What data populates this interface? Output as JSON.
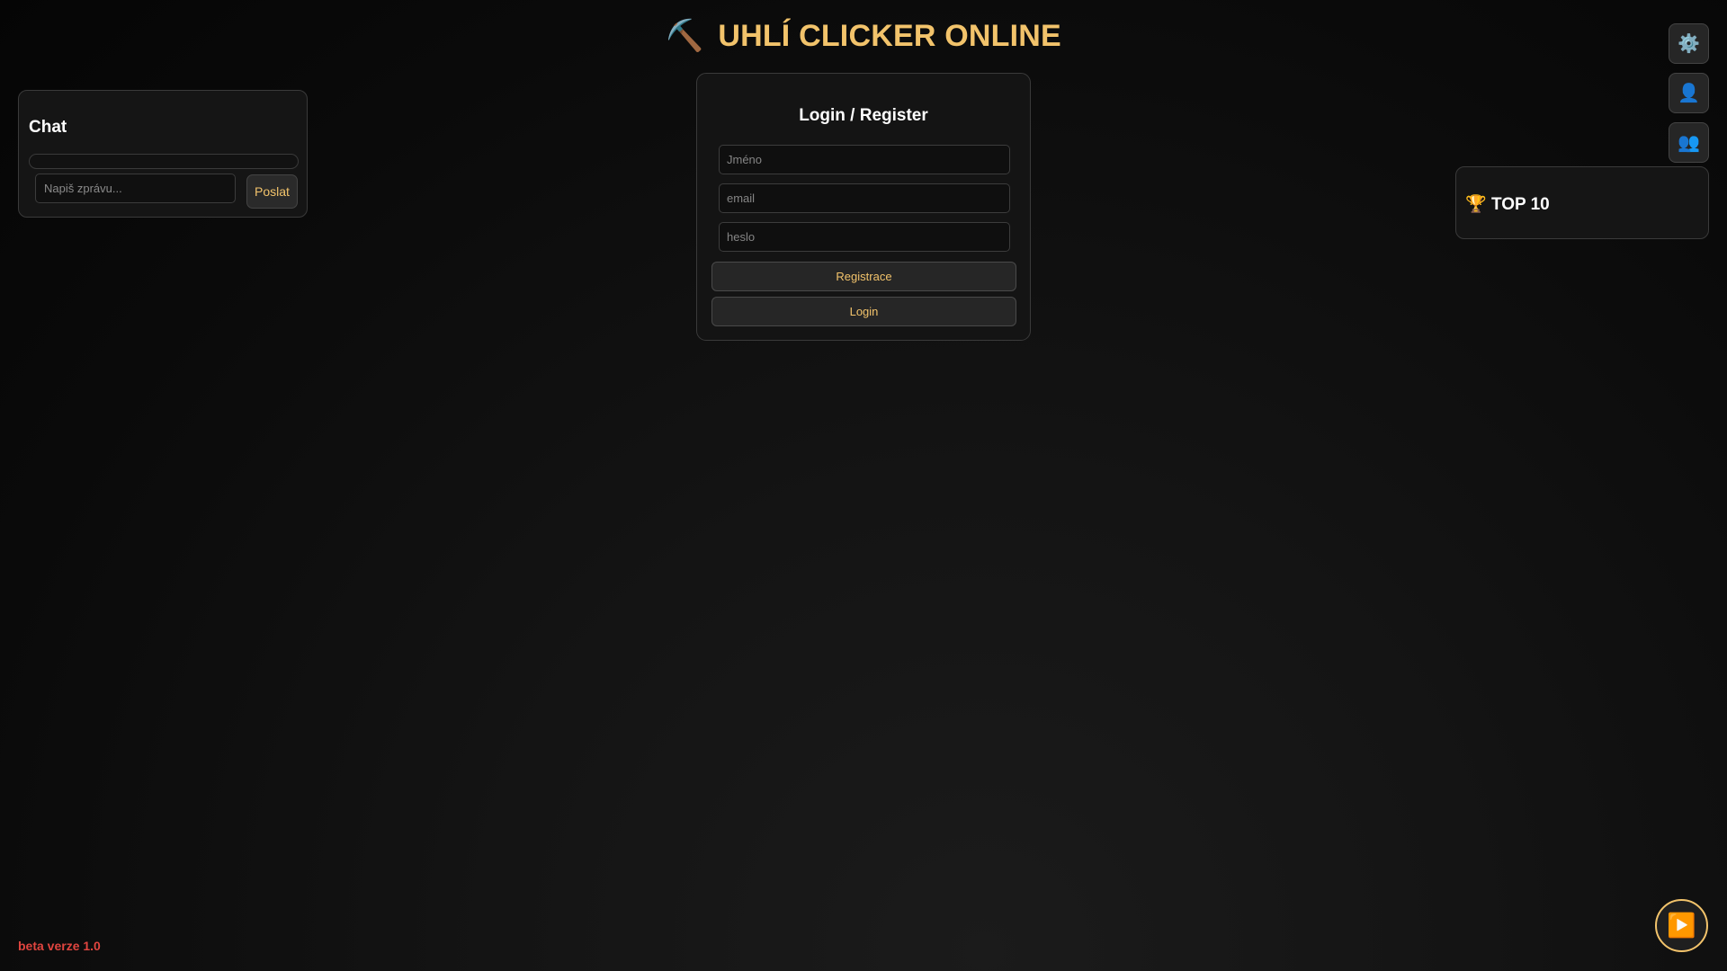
{
  "header": {
    "icon": "⛏️",
    "title": "UHLÍ CLICKER ONLINE"
  },
  "chat": {
    "title": "Chat",
    "input_placeholder": "Napiš zprávu...",
    "send_label": "Poslat"
  },
  "login": {
    "title": "Login / Register",
    "name_placeholder": "Jméno",
    "email_placeholder": "email",
    "password_placeholder": "heslo",
    "register_label": "Registrace",
    "login_label": "Login"
  },
  "side_buttons": {
    "settings_icon": "⚙️",
    "profile_icon": "👤",
    "friends_icon": "👥"
  },
  "leaderboard": {
    "icon": "🏆",
    "title": "TOP 10"
  },
  "footer": {
    "version": "beta verze 1.0"
  },
  "player": {
    "play_icon": "▶️"
  },
  "colors": {
    "accent": "#f2c36b",
    "beta": "#e0453f",
    "background": "#0a0a0a"
  }
}
